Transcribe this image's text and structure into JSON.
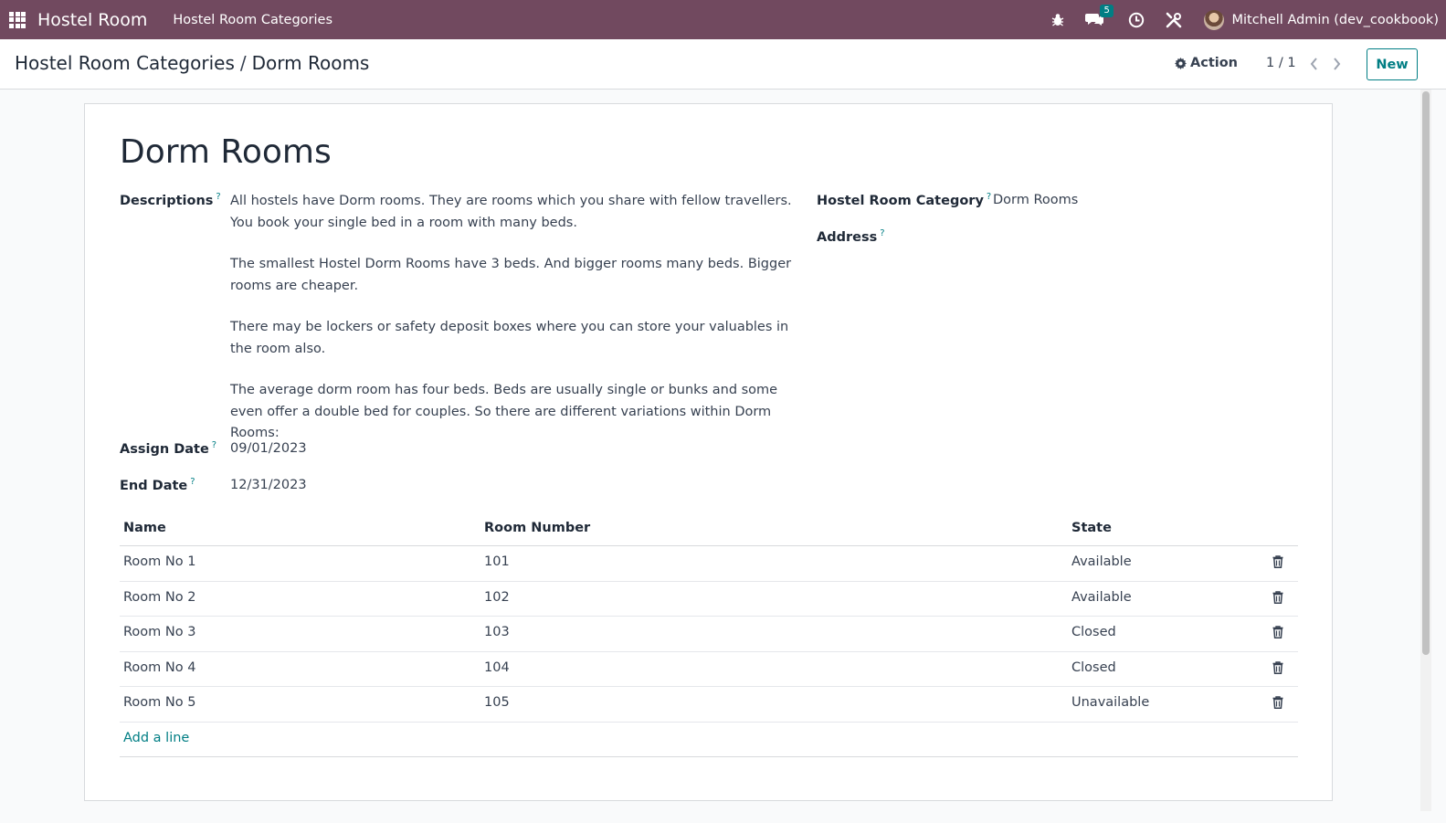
{
  "navbar": {
    "app_name": "Hostel Room",
    "menu_item": "Hostel Room Categories",
    "messages_badge": "5",
    "user_name": "Mitchell Admin (dev_cookbook)"
  },
  "control": {
    "breadcrumb_parent": "Hostel Room Categories",
    "breadcrumb_separator": "/",
    "breadcrumb_current": "Dorm Rooms",
    "action_label": "Action",
    "pager": "1 / 1",
    "new_label": "New"
  },
  "form": {
    "title": "Dorm Rooms",
    "descriptions_label": "Descriptions",
    "descriptions": [
      "All hostels have Dorm rooms. They are rooms which you share with fellow travellers. You book your single bed in a room with many beds.",
      "The smallest Hostel Dorm Rooms have 3 beds. And bigger rooms many beds. Bigger rooms are cheaper.",
      "There may be lockers or safety deposit boxes where you can store your valuables in the room also.",
      "The average dorm room has four beds. Beds are usually single or bunks and some even offer a double bed for couples. So there are different variations within Dorm Rooms:"
    ],
    "assign_date_label": "Assign Date",
    "assign_date": "09/01/2023",
    "end_date_label": "End Date",
    "end_date": "12/31/2023",
    "category_label": "Hostel Room Category",
    "category_value": "Dorm Rooms",
    "address_label": "Address",
    "help_mark": "?"
  },
  "table": {
    "headers": [
      "Name",
      "Room Number",
      "State"
    ],
    "rows": [
      {
        "name": "Room No 1",
        "number": "101",
        "state": "Available"
      },
      {
        "name": "Room No 2",
        "number": "102",
        "state": "Available"
      },
      {
        "name": "Room No 3",
        "number": "103",
        "state": "Closed"
      },
      {
        "name": "Room No 4",
        "number": "104",
        "state": "Closed"
      },
      {
        "name": "Room No 5",
        "number": "105",
        "state": "Unavailable"
      }
    ],
    "add_line": "Add a line"
  },
  "colors": {
    "navbar": "#71495f",
    "accent": "#017e84"
  }
}
